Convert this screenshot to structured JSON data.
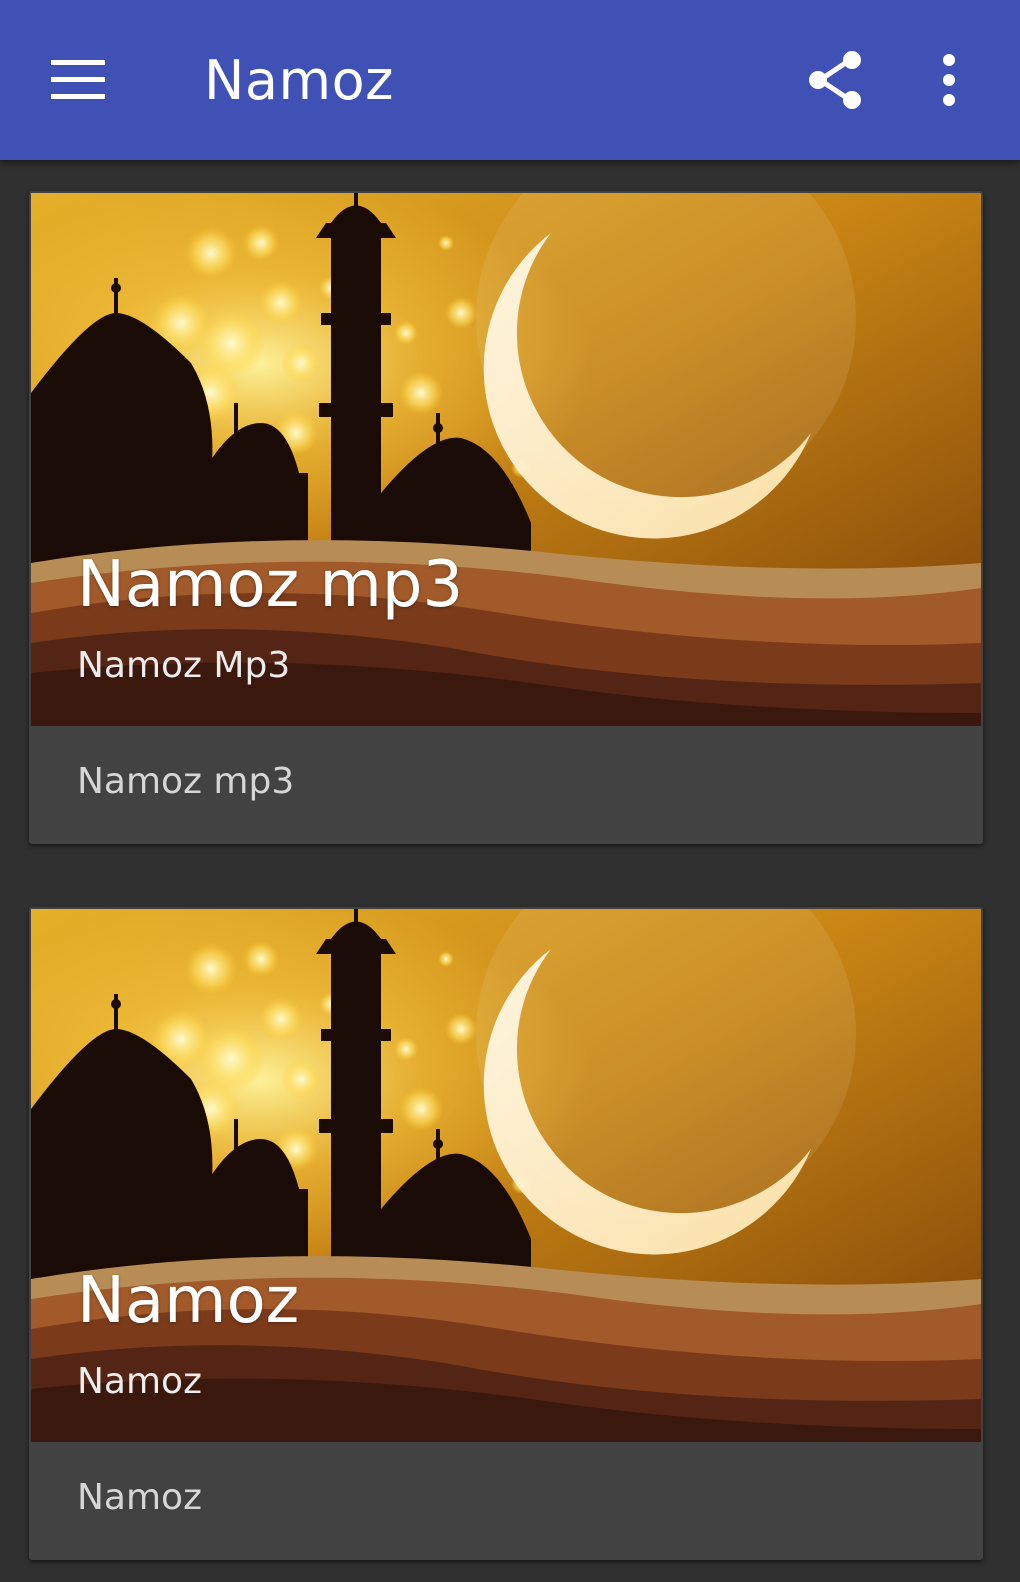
{
  "appbar": {
    "title": "Namoz",
    "icons": [
      "menu-icon",
      "share-icon",
      "more-vert-icon"
    ],
    "color": "#3f51b5"
  },
  "cards": [
    {
      "image": "mosque-crescent-moon-image",
      "headline": "Namoz mp3",
      "subhead": "Namoz Mp3",
      "supporting_text": "Namoz mp3"
    },
    {
      "image": "mosque-crescent-moon-image",
      "headline": "Namoz",
      "subhead": "Namoz",
      "supporting_text": "Namoz"
    }
  ],
  "colors": {
    "background": "#303030",
    "card": "#424242",
    "text_primary": "#ffffff",
    "text_secondary": "#d6d6d6"
  }
}
